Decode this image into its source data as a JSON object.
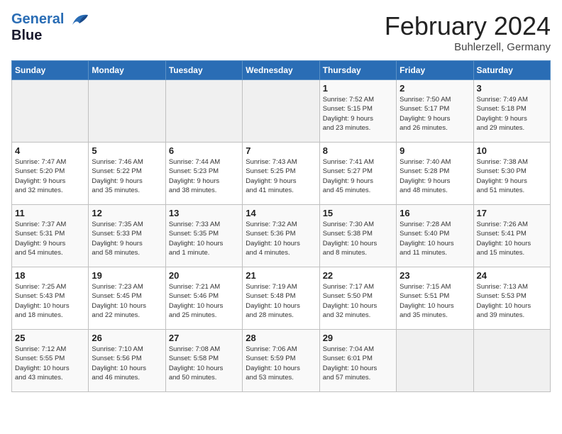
{
  "header": {
    "logo_line1": "General",
    "logo_line2": "Blue",
    "month_year": "February 2024",
    "location": "Buhlerzell, Germany"
  },
  "days_of_week": [
    "Sunday",
    "Monday",
    "Tuesday",
    "Wednesday",
    "Thursday",
    "Friday",
    "Saturday"
  ],
  "weeks": [
    [
      {
        "day": "",
        "info": ""
      },
      {
        "day": "",
        "info": ""
      },
      {
        "day": "",
        "info": ""
      },
      {
        "day": "",
        "info": ""
      },
      {
        "day": "1",
        "info": "Sunrise: 7:52 AM\nSunset: 5:15 PM\nDaylight: 9 hours\nand 23 minutes."
      },
      {
        "day": "2",
        "info": "Sunrise: 7:50 AM\nSunset: 5:17 PM\nDaylight: 9 hours\nand 26 minutes."
      },
      {
        "day": "3",
        "info": "Sunrise: 7:49 AM\nSunset: 5:18 PM\nDaylight: 9 hours\nand 29 minutes."
      }
    ],
    [
      {
        "day": "4",
        "info": "Sunrise: 7:47 AM\nSunset: 5:20 PM\nDaylight: 9 hours\nand 32 minutes."
      },
      {
        "day": "5",
        "info": "Sunrise: 7:46 AM\nSunset: 5:22 PM\nDaylight: 9 hours\nand 35 minutes."
      },
      {
        "day": "6",
        "info": "Sunrise: 7:44 AM\nSunset: 5:23 PM\nDaylight: 9 hours\nand 38 minutes."
      },
      {
        "day": "7",
        "info": "Sunrise: 7:43 AM\nSunset: 5:25 PM\nDaylight: 9 hours\nand 41 minutes."
      },
      {
        "day": "8",
        "info": "Sunrise: 7:41 AM\nSunset: 5:27 PM\nDaylight: 9 hours\nand 45 minutes."
      },
      {
        "day": "9",
        "info": "Sunrise: 7:40 AM\nSunset: 5:28 PM\nDaylight: 9 hours\nand 48 minutes."
      },
      {
        "day": "10",
        "info": "Sunrise: 7:38 AM\nSunset: 5:30 PM\nDaylight: 9 hours\nand 51 minutes."
      }
    ],
    [
      {
        "day": "11",
        "info": "Sunrise: 7:37 AM\nSunset: 5:31 PM\nDaylight: 9 hours\nand 54 minutes."
      },
      {
        "day": "12",
        "info": "Sunrise: 7:35 AM\nSunset: 5:33 PM\nDaylight: 9 hours\nand 58 minutes."
      },
      {
        "day": "13",
        "info": "Sunrise: 7:33 AM\nSunset: 5:35 PM\nDaylight: 10 hours\nand 1 minute."
      },
      {
        "day": "14",
        "info": "Sunrise: 7:32 AM\nSunset: 5:36 PM\nDaylight: 10 hours\nand 4 minutes."
      },
      {
        "day": "15",
        "info": "Sunrise: 7:30 AM\nSunset: 5:38 PM\nDaylight: 10 hours\nand 8 minutes."
      },
      {
        "day": "16",
        "info": "Sunrise: 7:28 AM\nSunset: 5:40 PM\nDaylight: 10 hours\nand 11 minutes."
      },
      {
        "day": "17",
        "info": "Sunrise: 7:26 AM\nSunset: 5:41 PM\nDaylight: 10 hours\nand 15 minutes."
      }
    ],
    [
      {
        "day": "18",
        "info": "Sunrise: 7:25 AM\nSunset: 5:43 PM\nDaylight: 10 hours\nand 18 minutes."
      },
      {
        "day": "19",
        "info": "Sunrise: 7:23 AM\nSunset: 5:45 PM\nDaylight: 10 hours\nand 22 minutes."
      },
      {
        "day": "20",
        "info": "Sunrise: 7:21 AM\nSunset: 5:46 PM\nDaylight: 10 hours\nand 25 minutes."
      },
      {
        "day": "21",
        "info": "Sunrise: 7:19 AM\nSunset: 5:48 PM\nDaylight: 10 hours\nand 28 minutes."
      },
      {
        "day": "22",
        "info": "Sunrise: 7:17 AM\nSunset: 5:50 PM\nDaylight: 10 hours\nand 32 minutes."
      },
      {
        "day": "23",
        "info": "Sunrise: 7:15 AM\nSunset: 5:51 PM\nDaylight: 10 hours\nand 35 minutes."
      },
      {
        "day": "24",
        "info": "Sunrise: 7:13 AM\nSunset: 5:53 PM\nDaylight: 10 hours\nand 39 minutes."
      }
    ],
    [
      {
        "day": "25",
        "info": "Sunrise: 7:12 AM\nSunset: 5:55 PM\nDaylight: 10 hours\nand 43 minutes."
      },
      {
        "day": "26",
        "info": "Sunrise: 7:10 AM\nSunset: 5:56 PM\nDaylight: 10 hours\nand 46 minutes."
      },
      {
        "day": "27",
        "info": "Sunrise: 7:08 AM\nSunset: 5:58 PM\nDaylight: 10 hours\nand 50 minutes."
      },
      {
        "day": "28",
        "info": "Sunrise: 7:06 AM\nSunset: 5:59 PM\nDaylight: 10 hours\nand 53 minutes."
      },
      {
        "day": "29",
        "info": "Sunrise: 7:04 AM\nSunset: 6:01 PM\nDaylight: 10 hours\nand 57 minutes."
      },
      {
        "day": "",
        "info": ""
      },
      {
        "day": "",
        "info": ""
      }
    ]
  ]
}
